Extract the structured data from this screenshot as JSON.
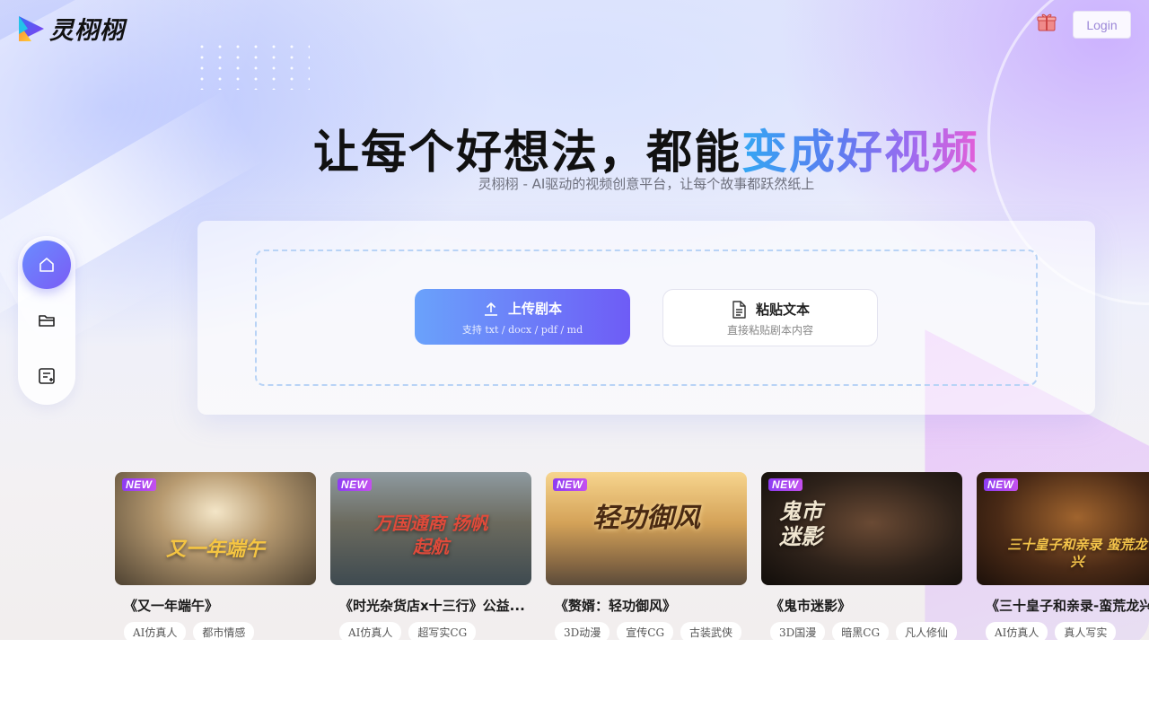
{
  "header": {
    "logo_text": "灵栩栩",
    "login_label": "Login",
    "gift_icon": "gift-icon"
  },
  "hero": {
    "title_plain": "让每个好想法，都能",
    "title_highlight": "变成好视频",
    "subtitle": "灵栩栩 - AI驱动的视频创意平台，让每个故事都跃然纸上"
  },
  "sidebar": {
    "items": [
      {
        "name": "home",
        "icon": "home-icon"
      },
      {
        "name": "projects",
        "icon": "folder-icon"
      },
      {
        "name": "script",
        "icon": "document-edit-icon"
      }
    ]
  },
  "upload": {
    "upload_label": "上传剧本",
    "upload_hint": "支持 txt / docx / pdf / md",
    "paste_label": "粘贴文本",
    "paste_hint": "直接粘贴剧本内容"
  },
  "works": [
    {
      "badge": "NEW",
      "title": "《又一年端午》",
      "caption": "又一年端午",
      "tags": [
        "AI仿真人",
        "都市情感"
      ],
      "colors": [
        "#6b5e4a",
        "#c9b08a"
      ]
    },
    {
      "badge": "NEW",
      "title": "《时光杂货店x十三行》公益...",
      "caption": "万国通商 扬帆起航",
      "tags": [
        "AI仿真人",
        "超写实CG"
      ],
      "colors": [
        "#4a5860",
        "#9aa3a0"
      ]
    },
    {
      "badge": "NEW",
      "title": "《赘婿：轻功御风》",
      "caption": "轻功御风",
      "tags": [
        "3D动漫",
        "宣传CG",
        "古装武侠"
      ],
      "colors": [
        "#b78a4e",
        "#f0d09a"
      ]
    },
    {
      "badge": "NEW",
      "title": "《鬼市迷影》",
      "caption": "鬼市迷影",
      "tags": [
        "3D国漫",
        "暗黑CG",
        "凡人修仙"
      ],
      "colors": [
        "#1a1512",
        "#5a3b2a"
      ]
    },
    {
      "badge": "NEW",
      "title": "《三十皇子和亲录-蛮荒龙兴》",
      "caption": "三十皇子和亲录 蛮荒龙兴",
      "tags": [
        "AI仿真人",
        "真人写实"
      ],
      "colors": [
        "#2a1a12",
        "#8a5a2a"
      ]
    }
  ]
}
